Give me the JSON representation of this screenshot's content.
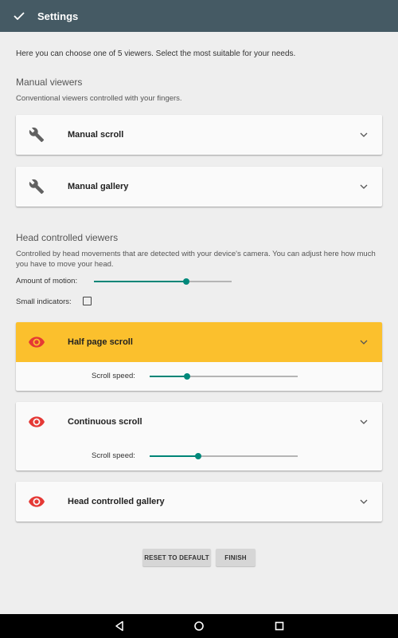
{
  "appbar": {
    "title": "Settings",
    "confirm_icon": "check-icon"
  },
  "intro": "Here you can choose one of 5 viewers. Select the most suitable for your needs.",
  "manual": {
    "title": "Manual viewers",
    "subtitle": "Conventional viewers controlled with your fingers.",
    "items": [
      {
        "label": "Manual scroll",
        "icon": "wrench-icon"
      },
      {
        "label": "Manual gallery",
        "icon": "wrench-icon"
      }
    ]
  },
  "head": {
    "title": "Head controlled viewers",
    "subtitle": "Controlled by head movements that are detected with your device's camera. You can adjust here how much you have to move your head.",
    "amount_label": "Amount of motion:",
    "amount_value": 0.67,
    "small_indicators_label": "Small indicators:",
    "small_indicators_checked": false,
    "items": [
      {
        "label": "Half page scroll",
        "icon": "eye-icon",
        "selected": true,
        "speed_label": "Scroll speed:",
        "speed_value": 0.25
      },
      {
        "label": "Continuous scroll",
        "icon": "eye-icon",
        "selected": false,
        "speed_label": "Scroll speed:",
        "speed_value": 0.33
      },
      {
        "label": "Head controlled gallery",
        "icon": "eye-icon",
        "selected": false
      }
    ]
  },
  "buttons": {
    "reset": "RESET TO DEFAULT",
    "finish": "FINISH"
  },
  "colors": {
    "appbar": "#455a64",
    "accent": "#00897b",
    "selected": "#fbc02d",
    "eye": "#e53935",
    "wrench": "#616161"
  },
  "navbar": {
    "back": "back-icon",
    "home": "home-icon",
    "recents": "recents-icon"
  }
}
